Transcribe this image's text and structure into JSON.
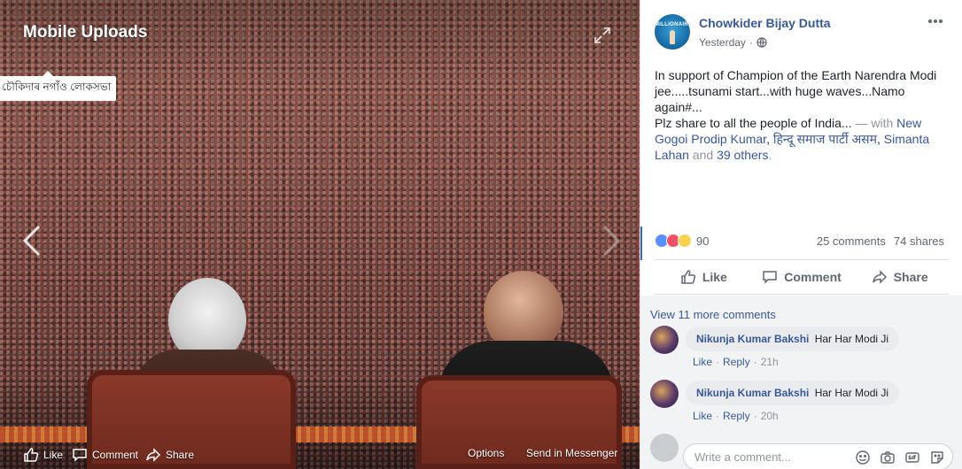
{
  "viewer": {
    "album_title": "Mobile Uploads",
    "tag_label": "চৌকিদাৰ নগাঁও লোকসভা",
    "bar": {
      "like": "Like",
      "comment": "Comment",
      "share": "Share",
      "options": "Options",
      "send": "Send in Messenger"
    }
  },
  "post": {
    "author": "Chowkider Bijay Dutta",
    "time": "Yesterday",
    "avatar_text": "MILLIONAIRE",
    "text_main": "In support of Champion of the Earth Narendra Modi jee.....tsunami start...with huge waves...Namo again#...",
    "text_line2": "Plz share to all the people of India...",
    "with_prefix": " — with ",
    "tag1": "New Gogoi Prodip Kumar",
    "sep1": ", ",
    "tag2": "हिन्दू समाज पार्टी असम",
    "sep2": ", ",
    "tag3": "Simanta Lahan",
    "and_text": " and ",
    "others": "39 others",
    "end": ".",
    "reaction_count": "90",
    "comments_count": "25 comments",
    "shares_count": "74 shares",
    "actions": {
      "like": "Like",
      "comment": "Comment",
      "share": "Share"
    }
  },
  "comments": {
    "view_more": "View 11 more comments",
    "items": [
      {
        "name": "Nikunja Kumar Bakshi",
        "text": "Har Har Modi Ji",
        "like": "Like",
        "reply": "Reply",
        "age": "21h"
      },
      {
        "name": "Nikunja Kumar Bakshi",
        "text": "Har Har Modi Ji",
        "like": "Like",
        "reply": "Reply",
        "age": "20h"
      }
    ],
    "write_placeholder": "Write a comment..."
  },
  "colors": {
    "link": "#385898",
    "like_reaction": "#5890ff",
    "love_reaction": "#f25268",
    "haha_reaction": "#fcd050"
  },
  "icons": [
    "expand-icon",
    "chevron-left-icon",
    "chevron-right-icon",
    "thumbs-up-icon",
    "comment-icon",
    "share-icon",
    "globe-icon",
    "more-icon",
    "smiley-icon",
    "camera-icon",
    "gif-icon",
    "sticker-icon"
  ]
}
